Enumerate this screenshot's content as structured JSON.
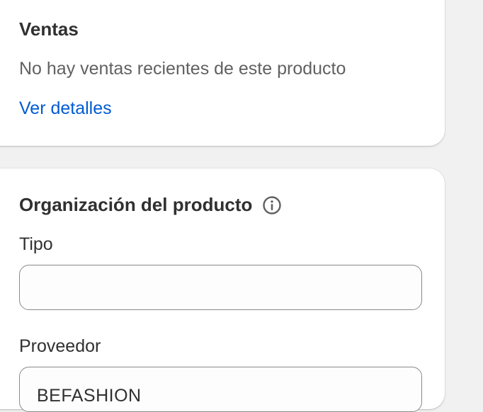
{
  "sales_card": {
    "title": "Ventas",
    "message": "No hay ventas recientes de este producto",
    "details_link": "Ver detalles",
    "link_color": "#005bd3"
  },
  "organization_card": {
    "title": "Organización del producto",
    "info_icon": "info-circle-icon",
    "type_field": {
      "label": "Tipo",
      "value": ""
    },
    "vendor_field": {
      "label": "Proveedor",
      "value": "BEFASHION"
    }
  }
}
